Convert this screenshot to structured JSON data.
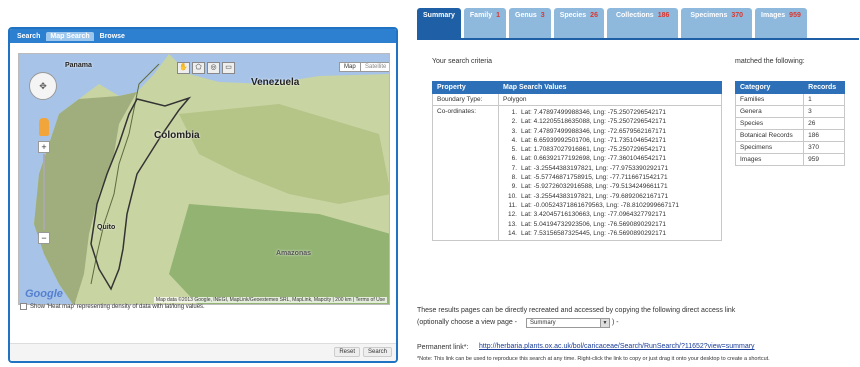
{
  "left": {
    "tabs": [
      "Search",
      "Map Search",
      "Browse"
    ],
    "map": {
      "type_buttons": [
        "Map",
        "Satellite"
      ],
      "labels": {
        "panama": "Panama",
        "venezuela": "Venezuela",
        "colombia": "Colombia",
        "quito": "Quito",
        "amazonas": "Amazonas"
      },
      "logo": "Google",
      "credit": "Map data ©2013 Google, INEGI, MapLink/Geoestemes SRL, MapLink, Mapcity | 200 km | Terms of Use"
    },
    "heat_map_label": "Show 'Heat map' representing density of data with lat/long values.",
    "reset": "Reset",
    "search": "Search"
  },
  "right": {
    "tabs": [
      {
        "label": "Summary",
        "count": ""
      },
      {
        "label": "Family",
        "count": "1"
      },
      {
        "label": "Genus",
        "count": "3"
      },
      {
        "label": "Species",
        "count": "26"
      },
      {
        "label": "Collections",
        "count": "186"
      },
      {
        "label": "Specimens",
        "count": "370"
      },
      {
        "label": "Images",
        "count": "959"
      }
    ],
    "criteria_label": "Your search criteria",
    "matched_label": "matched the following:",
    "criteria_headers": [
      "Property",
      "Map Search Values"
    ],
    "boundary_type_label": "Boundary Type:",
    "boundary_type_value": "Polygon",
    "coordinates_label": "Co-ordinates:",
    "coordinates": [
      {
        "n": "1.",
        "text": "Lat: 7.47897499988346, Lng: -75.2507296542171"
      },
      {
        "n": "2.",
        "text": "Lat: 4.12205518635088, Lng: -75.2507296542171"
      },
      {
        "n": "3.",
        "text": "Lat: 7.47897499988346, Lng: -72.6579562167171"
      },
      {
        "n": "4.",
        "text": "Lat: 6.65939992501706, Lng: -71.7351046542171"
      },
      {
        "n": "5.",
        "text": "Lat: 1.70837027916861, Lng: -75.2507296542171"
      },
      {
        "n": "6.",
        "text": "Lat: 0.66392177192698, Lng: -77.3601046542171"
      },
      {
        "n": "7.",
        "text": "Lat: -3.25544383197821, Lng: -77.9753390292171"
      },
      {
        "n": "8.",
        "text": "Lat: -5.57746871758915, Lng: -77.7116671542171"
      },
      {
        "n": "9.",
        "text": "Lat: -5.92726032916588, Lng: -79.5134249661171"
      },
      {
        "n": "10.",
        "text": "Lat: -3.25544383197821, Lng: -79.6892062167171"
      },
      {
        "n": "11.",
        "text": "Lat: -0.00524371861679563, Lng: -78.8102999667171"
      },
      {
        "n": "12.",
        "text": "Lat: 3.42045716130663, Lng: -77.0964327792171"
      },
      {
        "n": "13.",
        "text": "Lat: 5.04194732923506, Lng: -76.5690890292171"
      },
      {
        "n": "14.",
        "text": "Lat: 7.53156587325445, Lng: -76.5690890292171"
      }
    ],
    "match_headers": [
      "Category",
      "Records"
    ],
    "matches": [
      {
        "category": "Families",
        "records": "1"
      },
      {
        "category": "Genera",
        "records": "3"
      },
      {
        "category": "Species",
        "records": "26"
      },
      {
        "category": "Botanical Records",
        "records": "186"
      },
      {
        "category": "Specimens",
        "records": "370"
      },
      {
        "category": "Images",
        "records": "959"
      }
    ],
    "results_note": "These results pages can be directly recreated and accessed by copying the following direct access link",
    "view_page_label": "(optionally choose a view page -",
    "view_page_value": "Summary",
    "view_page_suffix": ") -",
    "permanent_label": "Permanent link*:",
    "permanent_link": "http://herbaria.plants.ox.ac.uk/bol/caricaceae/Search/RunSearch/?11652?view=summary",
    "footnote": "*Note: This link can be used to reproduce this search at any time. Right-click the link to copy or just drag it onto your desktop to create a shortcut."
  },
  "colors": {
    "tab_active": "#1f5fa6",
    "tab": "#8fb8dd",
    "count": "#d9372f",
    "panel_border": "#1f73c2",
    "table_header": "#2d70b7"
  }
}
